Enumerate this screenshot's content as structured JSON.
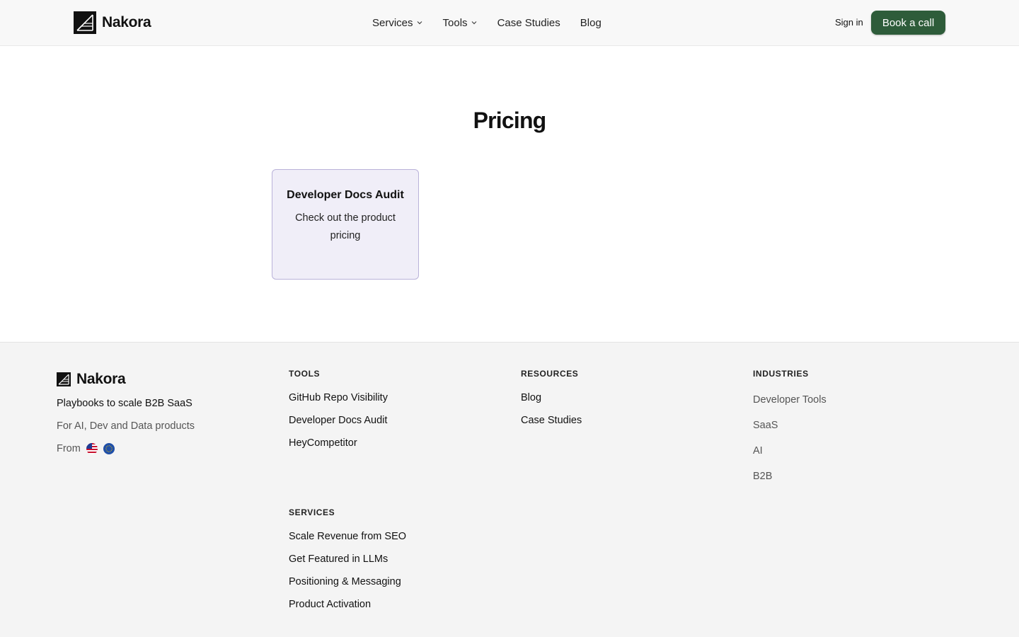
{
  "header": {
    "brand": "Nakora",
    "nav": [
      {
        "label": "Services",
        "dropdown": true
      },
      {
        "label": "Tools",
        "dropdown": true
      },
      {
        "label": "Case Studies",
        "dropdown": false
      },
      {
        "label": "Blog",
        "dropdown": false
      }
    ],
    "signin": "Sign in",
    "cta": "Book a call"
  },
  "main": {
    "title": "Pricing",
    "cards": [
      {
        "title": "Developer Docs Audit",
        "description": "Check out the product pricing"
      }
    ]
  },
  "footer": {
    "brand": "Nakora",
    "tagline": "Playbooks to scale B2B SaaS",
    "subtext": "For AI, Dev and Data products",
    "from_label": "From",
    "tools": {
      "heading": "TOOLS",
      "links": [
        "GitHub Repo Visibility",
        "Developer Docs Audit",
        "HeyCompetitor"
      ]
    },
    "services": {
      "heading": "SERVICES",
      "links": [
        "Scale Revenue from SEO",
        "Get Featured in LLMs",
        "Positioning & Messaging",
        "Product Activation"
      ]
    },
    "resources": {
      "heading": "RESOURCES",
      "links": [
        "Blog",
        "Case Studies"
      ]
    },
    "industries": {
      "heading": "INDUSTRIES",
      "links": [
        "Developer Tools",
        "SaaS",
        "AI",
        "B2B"
      ]
    }
  },
  "colors": {
    "accent": "#2e5c3a",
    "card_bg": "#f0eef8",
    "card_border": "#b9b2d9",
    "footer_bg": "#f4f4f4",
    "header_bg": "#f8f8f8"
  },
  "icons": [
    "logo-icon",
    "chevron-down-icon",
    "us-flag-icon",
    "eu-flag-icon"
  ]
}
